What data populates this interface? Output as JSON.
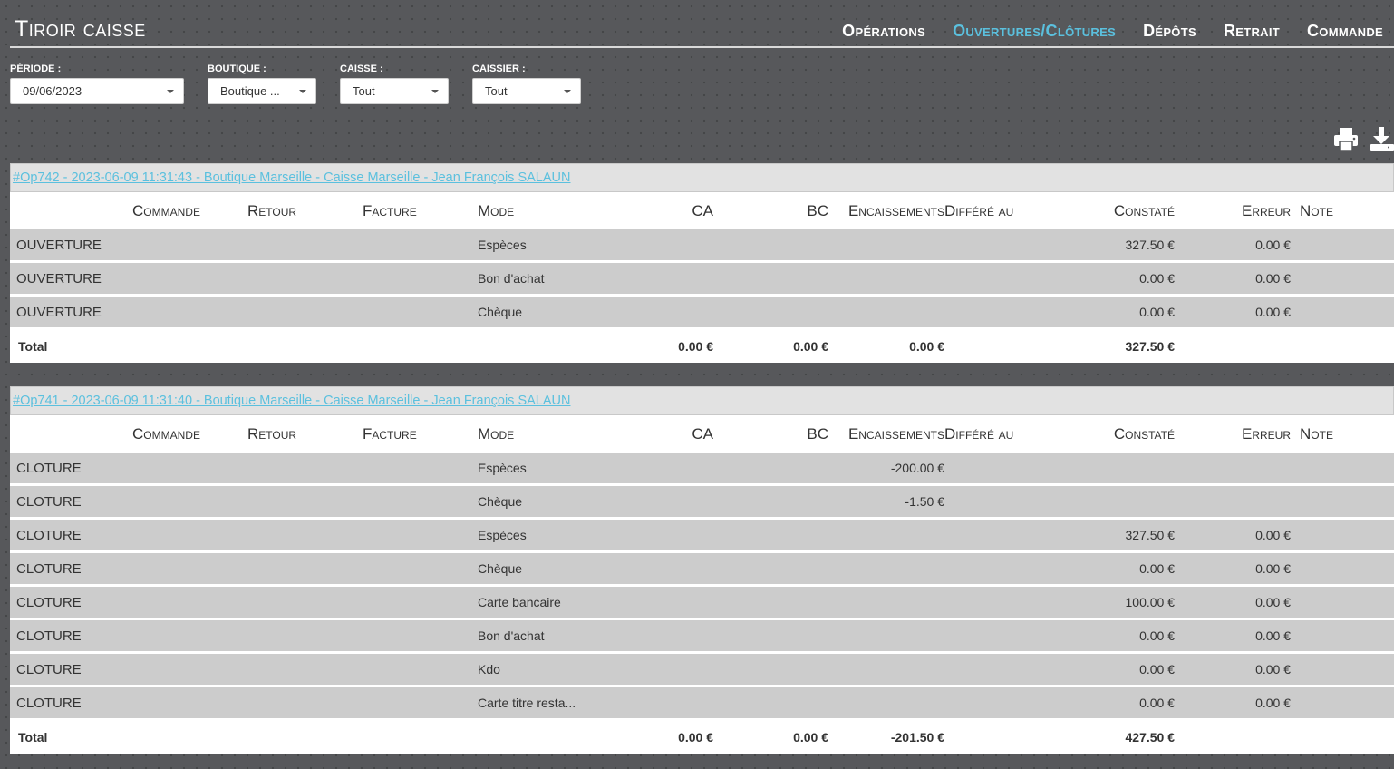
{
  "app": {
    "title": "Tiroir caisse"
  },
  "nav": {
    "items": [
      {
        "label": "Opérations",
        "active": false
      },
      {
        "label": "Ouvertures/Clôtures",
        "active": true
      },
      {
        "label": "Dépôts",
        "active": false
      },
      {
        "label": "Retrait",
        "active": false
      },
      {
        "label": "Commande",
        "active": false
      }
    ]
  },
  "filters": [
    {
      "label": "Période :",
      "value": "09/06/2023"
    },
    {
      "label": "Boutique :",
      "value": "Boutique ..."
    },
    {
      "label": "Caisse :",
      "value": "Tout"
    },
    {
      "label": "Caissier :",
      "value": "Tout"
    }
  ],
  "toolbar": {
    "icons": [
      "print-icon",
      "download-icon"
    ]
  },
  "colors": {
    "accent": "#5bc0de",
    "background": "#57585b",
    "row": "#cccccc"
  },
  "columns": [
    "",
    "Commande",
    "Retour",
    "Facture",
    "Mode",
    "CA",
    "BC",
    "Encaissements",
    "Différé au",
    "Constaté",
    "Erreur",
    "Note"
  ],
  "operations": [
    {
      "title": "#Op742 - 2023-06-09 11:31:43 - Boutique Marseille - Caisse Marseille - Jean François SALAUN",
      "rows": [
        [
          "OUVERTURE",
          "",
          "",
          "",
          "Espèces",
          "",
          "",
          "",
          "",
          "327.50 €",
          "0.00 €",
          ""
        ],
        [
          "OUVERTURE",
          "",
          "",
          "",
          "Bon d'achat",
          "",
          "",
          "",
          "",
          "0.00 €",
          "0.00 €",
          ""
        ],
        [
          "OUVERTURE",
          "",
          "",
          "",
          "Chèque",
          "",
          "",
          "",
          "",
          "0.00 €",
          "0.00 €",
          ""
        ]
      ],
      "total": [
        "Total",
        "",
        "",
        "",
        "",
        "0.00 €",
        "0.00 €",
        "0.00 €",
        "",
        "327.50 €",
        "",
        ""
      ]
    },
    {
      "title": "#Op741 - 2023-06-09 11:31:40 - Boutique Marseille - Caisse Marseille - Jean François SALAUN",
      "rows": [
        [
          "CLOTURE",
          "",
          "",
          "",
          "Espèces",
          "",
          "",
          "-200.00 €",
          "",
          "",
          "",
          ""
        ],
        [
          "CLOTURE",
          "",
          "",
          "",
          "Chèque",
          "",
          "",
          "-1.50 €",
          "",
          "",
          "",
          ""
        ],
        [
          "CLOTURE",
          "",
          "",
          "",
          "Espèces",
          "",
          "",
          "",
          "",
          "327.50 €",
          "0.00 €",
          ""
        ],
        [
          "CLOTURE",
          "",
          "",
          "",
          "Chèque",
          "",
          "",
          "",
          "",
          "0.00 €",
          "0.00 €",
          ""
        ],
        [
          "CLOTURE",
          "",
          "",
          "",
          "Carte bancaire",
          "",
          "",
          "",
          "",
          "100.00 €",
          "0.00 €",
          ""
        ],
        [
          "CLOTURE",
          "",
          "",
          "",
          "Bon d'achat",
          "",
          "",
          "",
          "",
          "0.00 €",
          "0.00 €",
          ""
        ],
        [
          "CLOTURE",
          "",
          "",
          "",
          "Kdo",
          "",
          "",
          "",
          "",
          "0.00 €",
          "0.00 €",
          ""
        ],
        [
          "CLOTURE",
          "",
          "",
          "",
          "Carte titre resta...",
          "",
          "",
          "",
          "",
          "0.00 €",
          "0.00 €",
          ""
        ]
      ],
      "total": [
        "Total",
        "",
        "",
        "",
        "",
        "0.00 €",
        "0.00 €",
        "-201.50 €",
        "",
        "427.50 €",
        "",
        ""
      ]
    }
  ]
}
